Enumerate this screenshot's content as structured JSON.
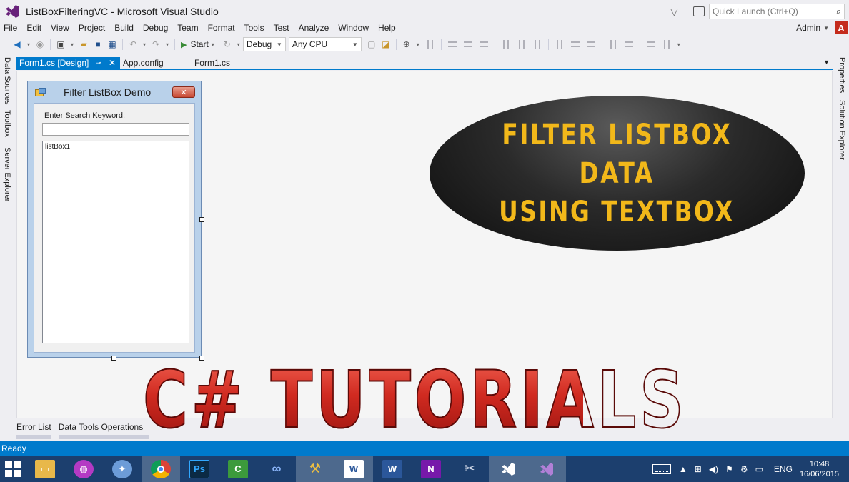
{
  "window": {
    "title": "ListBoxFilteringVC - Microsoft Visual Studio",
    "quick_launch_placeholder": "Quick Launch (Ctrl+Q)"
  },
  "menu": {
    "items": [
      "File",
      "Edit",
      "View",
      "Project",
      "Build",
      "Debug",
      "Team",
      "Format",
      "Tools",
      "Test",
      "Analyze",
      "Window",
      "Help"
    ],
    "user": "Admin",
    "user_initial": "A"
  },
  "toolbar": {
    "start_label": "Start",
    "config": "Debug",
    "platform": "Any CPU"
  },
  "tabs": [
    {
      "label": "Form1.cs [Design]",
      "active": true
    },
    {
      "label": "App.config",
      "active": false
    },
    {
      "label": "Form1.cs",
      "active": false
    }
  ],
  "left_panels": [
    "Data Sources",
    "Toolbox",
    "Server Explorer"
  ],
  "right_panels": [
    "Properties",
    "Solution Explorer"
  ],
  "form": {
    "title": "Filter ListBox Demo",
    "label": "Enter Search Keyword:",
    "listbox_text": "listBox1"
  },
  "overlay": {
    "line1": "FILTER LISTBOX",
    "line2": "DATA",
    "line3": "USING TEXTBOX",
    "headline": "C# TUTORIALS"
  },
  "bottom_tabs": [
    "Error List",
    "Data Tools Operations"
  ],
  "status": "Ready",
  "taskbar": {
    "language": "ENG",
    "time": "10:48",
    "date": "16/06/2015"
  },
  "colors": {
    "accent": "#007acc",
    "taskbar": "#1c3f6e",
    "banner_text": "#f2b81a",
    "headline": "#d42a22"
  }
}
